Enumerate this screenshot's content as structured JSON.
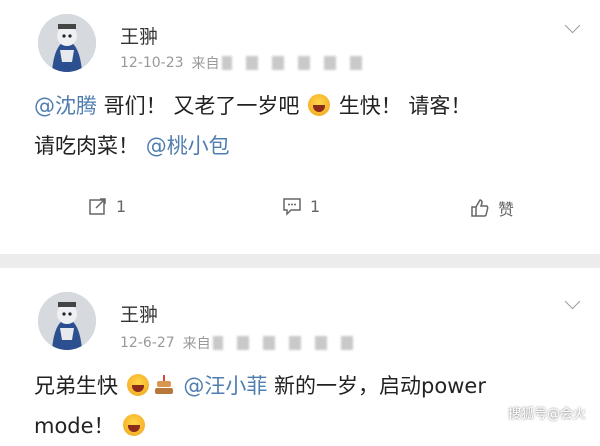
{
  "posts": [
    {
      "username": "王翀",
      "date": "12-10-23",
      "source_prefix": "来自",
      "body": {
        "mention1": "@沈腾",
        "text1": " 哥们！ 又老了一岁吧",
        "text2": " 生快！ 请客！",
        "text3": "请吃肉菜！ ",
        "mention2": "@桃小包"
      },
      "actions": {
        "share_count": "1",
        "comment_count": "1",
        "like_label": "赞"
      }
    },
    {
      "username": "王翀",
      "date": "12-6-27",
      "source_prefix": "来自",
      "body": {
        "text1": "兄弟生快",
        "mention1": "@汪小菲",
        "text2": " 新的一岁，启动power",
        "text3": "mode！"
      }
    }
  ],
  "watermark": "搜狐号@会火",
  "icons": [
    "share-icon",
    "comment-icon",
    "like-icon",
    "chevron-down-icon",
    "laugh-emoji",
    "cake-emoji"
  ]
}
